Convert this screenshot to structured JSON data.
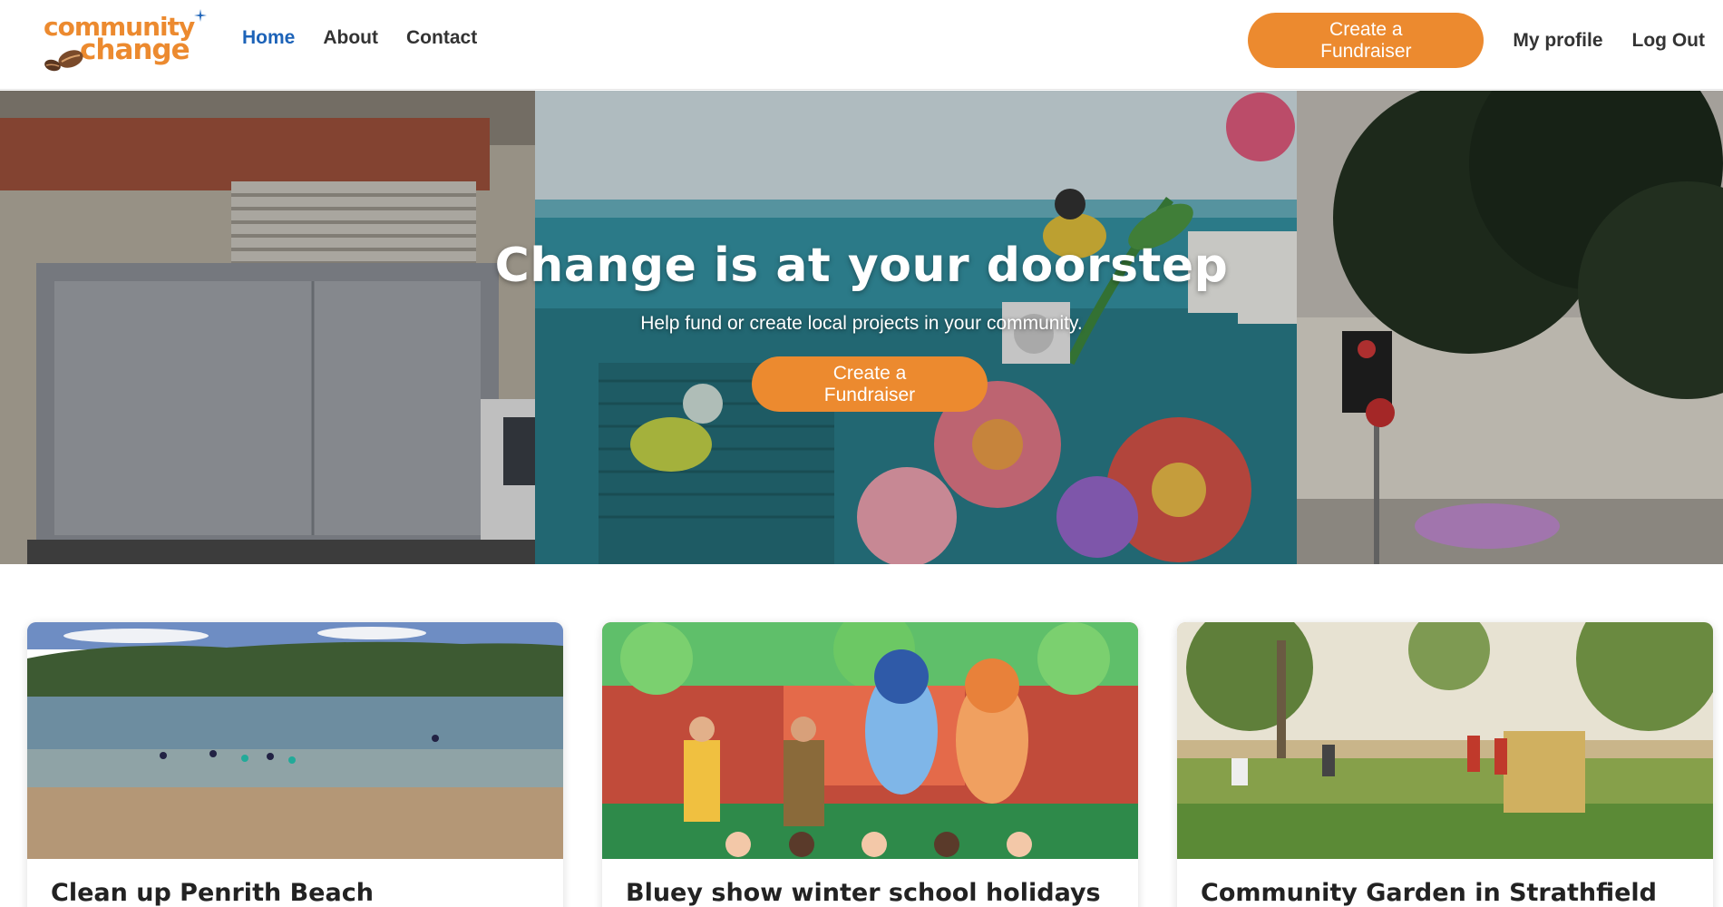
{
  "brand": {
    "line1": "community",
    "line2": "change",
    "color": "#ec8a2f"
  },
  "nav": {
    "links": [
      {
        "label": "Home",
        "active": true
      },
      {
        "label": "About",
        "active": false
      },
      {
        "label": "Contact",
        "active": false
      }
    ],
    "cta_label": "Create a Fundraiser",
    "profile_label": "My profile",
    "logout_label": "Log Out"
  },
  "hero": {
    "title": "Change is at your doorstep",
    "subtitle": "Help fund or create local projects in your community.",
    "cta_label": "Create a Fundraiser",
    "image_icon": "street-mural-photo"
  },
  "cards": [
    {
      "title": "Clean up Penrith Beach",
      "image_icon": "lake-beach-photo"
    },
    {
      "title": "Bluey show winter school holidays",
      "image_icon": "stage-show-photo"
    },
    {
      "title": "Community Garden in Strathfield",
      "image_icon": "garden-photo"
    }
  ],
  "colors": {
    "accent": "#ec8a2f",
    "link_active": "#1d63b8"
  }
}
